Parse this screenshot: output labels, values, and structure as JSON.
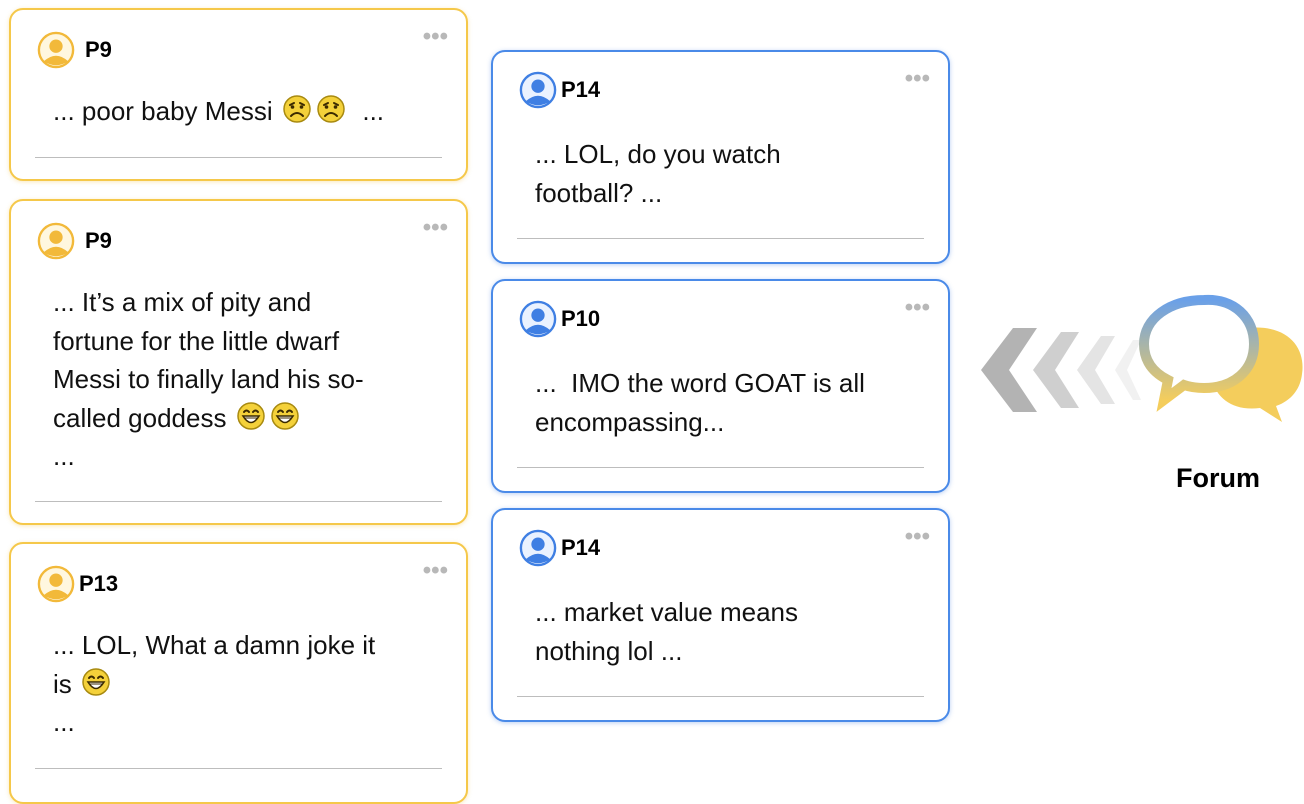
{
  "posts_left": [
    {
      "user": "P9",
      "lines": [
        "... poor baby Messi",
        "..."
      ],
      "emoji": [
        "sad",
        "sad"
      ]
    },
    {
      "user": "P9",
      "lines": [
        "... It’s a mix of pity and",
        "fortune for the little dwarf",
        "Messi to finally land his so-",
        "called goddess",
        "..."
      ],
      "emoji": [
        "grin",
        "grin"
      ]
    },
    {
      "user": "P13",
      "lines": [
        "... LOL, What a damn joke it",
        "is",
        "..."
      ],
      "emoji": [
        "grin"
      ]
    }
  ],
  "posts_right": [
    {
      "user": "P14",
      "lines": [
        "... LOL, do you watch",
        "football? ..."
      ]
    },
    {
      "user": "P10",
      "lines": [
        "...  IMO the word GOAT is all",
        "encompassing..."
      ]
    },
    {
      "user": "P14",
      "lines": [
        "... market value means",
        "nothing lol ..."
      ]
    }
  ],
  "more_label": "•••",
  "forum": {
    "label": "Forum",
    "icon": "speech-bubbles-icon",
    "arrows_icon": "chevrons-left-icon"
  },
  "colors": {
    "yellow": "#f5c84a",
    "blue": "#4a8ae8",
    "gray": "#b8b8b8"
  }
}
